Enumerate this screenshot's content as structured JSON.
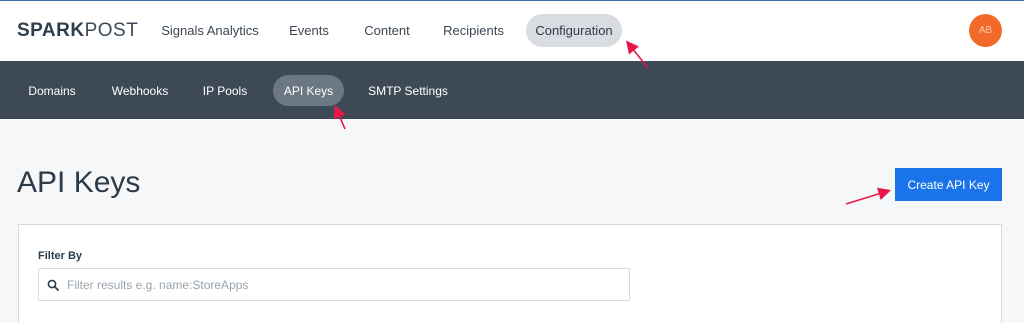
{
  "brand": {
    "spark": "SPARK",
    "post": "POST"
  },
  "topnav": [
    {
      "label": "Signals Analytics"
    },
    {
      "label": "Events"
    },
    {
      "label": "Content"
    },
    {
      "label": "Recipients"
    },
    {
      "label": "Configuration",
      "active": true
    }
  ],
  "avatar": {
    "initials": "AB",
    "color": "#f26a2a"
  },
  "subnav": [
    {
      "label": "Domains"
    },
    {
      "label": "Webhooks"
    },
    {
      "label": "IP Pools"
    },
    {
      "label": "API Keys",
      "active": true
    },
    {
      "label": "SMTP Settings"
    }
  ],
  "page": {
    "title": "API Keys",
    "create_button": "Create API Key"
  },
  "filter": {
    "label": "Filter By",
    "placeholder": "Filter results e.g. name:StoreApps",
    "value": ""
  },
  "colors": {
    "primary": "#1a73e8",
    "subnav_bg": "#3d4a56",
    "annotation": "#e8174a",
    "brand_orange": "#f26a2a"
  },
  "icons": {
    "logo_flame": "flame-icon",
    "search": "search-icon"
  }
}
